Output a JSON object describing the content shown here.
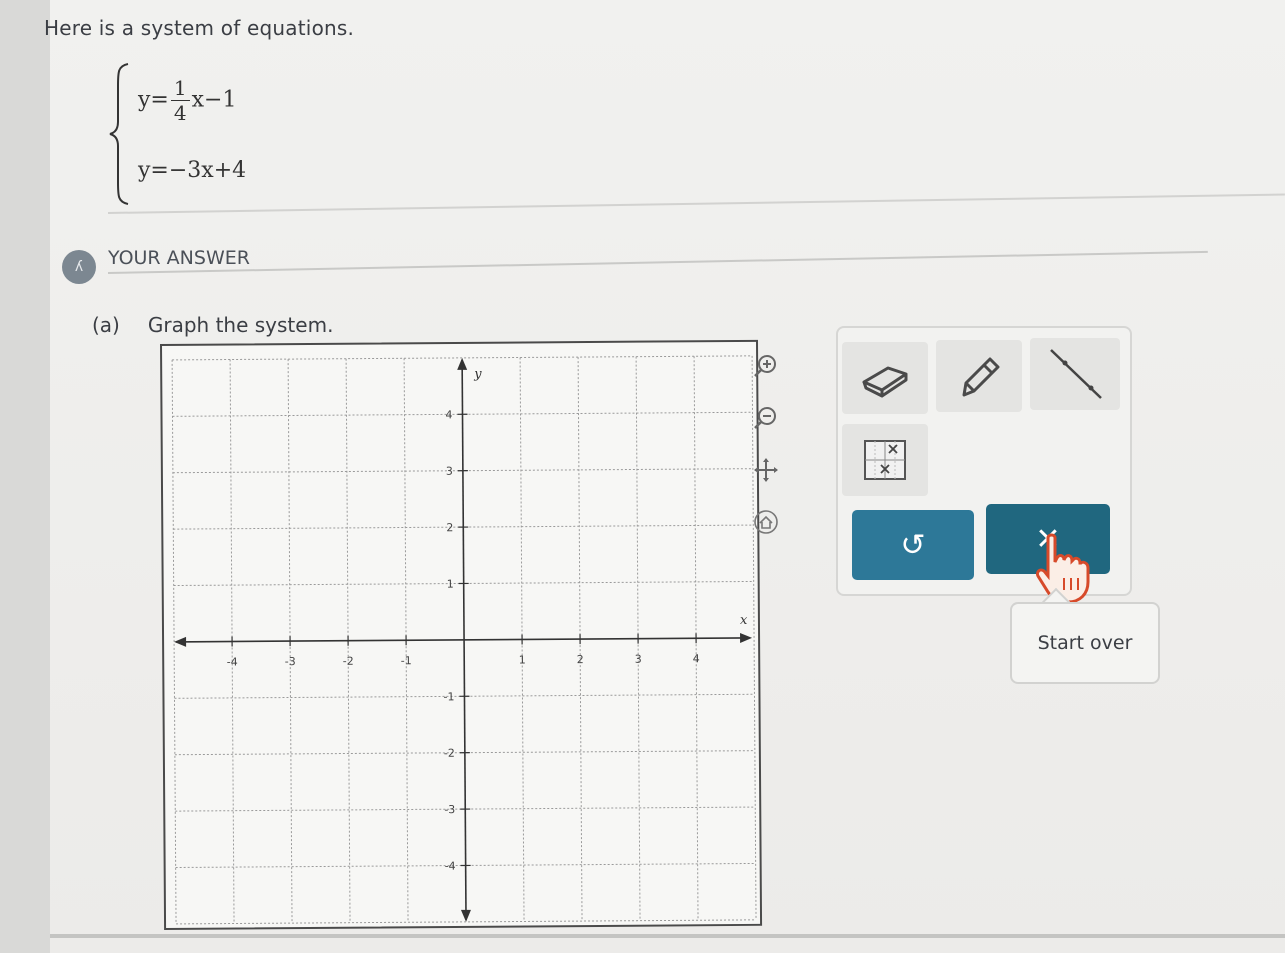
{
  "problem": {
    "intro": "Here is a system of equations.",
    "eq1": {
      "lhs": "y=",
      "num": "1",
      "den": "4",
      "rest": "x−1"
    },
    "eq2": {
      "text": "y=−3x+4"
    }
  },
  "answer": {
    "badge": "ʎ",
    "label": "YOUR ANSWER",
    "part_letter": "(a)",
    "part_text": "Graph the system."
  },
  "graph": {
    "x_label": "x",
    "y_label": "y",
    "x_range": [
      -5,
      5
    ],
    "y_range": [
      -5,
      5
    ],
    "x_ticks": [
      "-4",
      "-3",
      "-2",
      "-1",
      "1",
      "2",
      "3",
      "4"
    ],
    "y_ticks": [
      "4",
      "3",
      "2",
      "1",
      "-1",
      "-2",
      "-3",
      "-4"
    ]
  },
  "side_tools": [
    {
      "name": "zoom-in-icon"
    },
    {
      "name": "zoom-out-icon"
    },
    {
      "name": "move-icon"
    },
    {
      "name": "home-icon"
    }
  ],
  "toolbar": {
    "tools": [
      "eraser-icon",
      "pencil-icon",
      "line-tool-icon",
      "point-tool-icon"
    ],
    "undo_symbol": "↺",
    "clear_symbol": "✕",
    "tooltip": "Start over",
    "accent": "#2d7898",
    "accent_dark": "#20677f"
  }
}
